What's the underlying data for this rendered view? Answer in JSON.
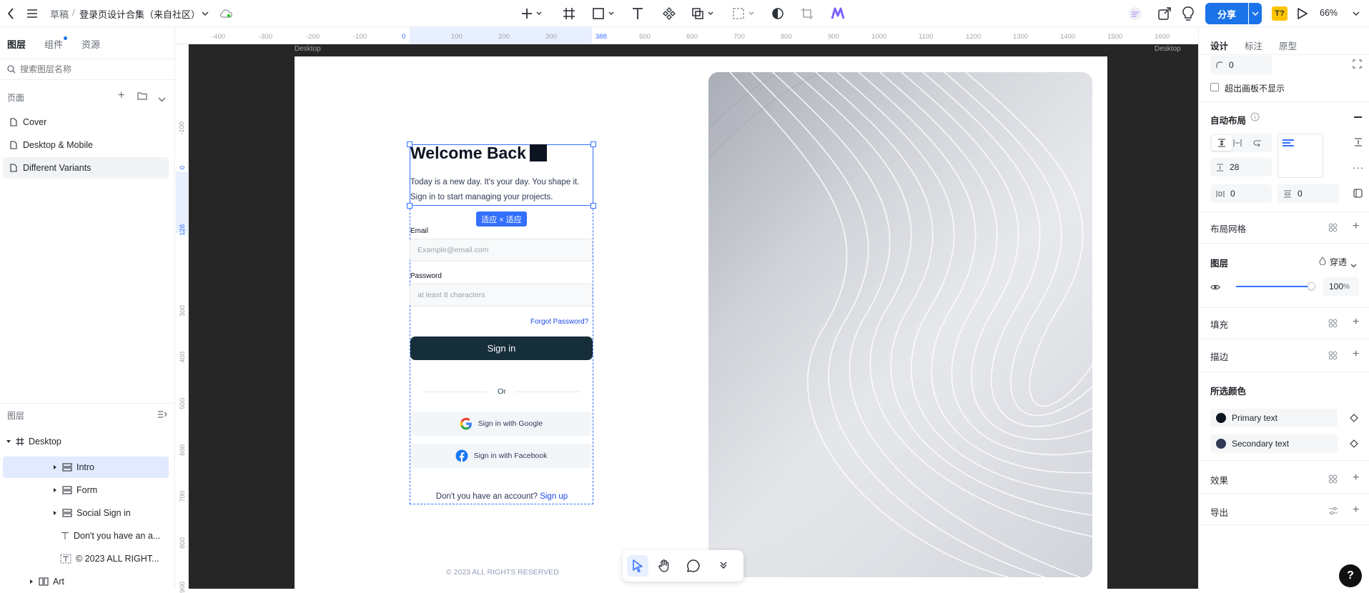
{
  "topbar": {
    "breadcrumb_parent": "草稿",
    "breadcrumb_sep": "/",
    "file_name": "登录页设计合集（来自社区）",
    "share_label": "分享",
    "zoom": "66%"
  },
  "left_panel": {
    "tabs": [
      "图层",
      "组件",
      "资源"
    ],
    "search_placeholder": "搜索图层名称",
    "pages_title": "页面",
    "pages": [
      "Cover",
      "Desktop & Mobile",
      "Different Variants"
    ],
    "layers_title": "图层",
    "layers": {
      "root": "Desktop",
      "children": [
        "Intro",
        "Form",
        "Social Sign in",
        "Don't you have an a...",
        "© 2023 ALL RIGHT...",
        "Art"
      ]
    }
  },
  "rulers": {
    "h": [
      "-400",
      "-300",
      "-200",
      "-100",
      "0",
      "100",
      "200",
      "300",
      "388",
      "500",
      "600",
      "700",
      "800",
      "900",
      "1000",
      "1100",
      "1200",
      "1300",
      "1400",
      "1500",
      "1600"
    ],
    "v": [
      "-100",
      "0",
      "128",
      "300",
      "400",
      "500",
      "600",
      "700",
      "800",
      "900"
    ]
  },
  "canvas": {
    "frame_label": "Desktop",
    "frame_label_right": "Desktop",
    "size_badge": "适应 × 适应",
    "welcome": "Welcome Back",
    "subtitle_1": "Today is a new day. It's your day. You shape it.",
    "subtitle_2": "Sign in to start managing your projects.",
    "email_label": "Email",
    "email_placeholder": "Example@email.com",
    "password_label": "Password",
    "password_placeholder": "at least 8 characters",
    "forgot": "Forgot Password?",
    "signin": "Sign in",
    "or": "Or",
    "google": "Sign in with Google",
    "facebook": "Sign in with Facebook",
    "no_account": "Don't you have an account?",
    "signup": "Sign up",
    "copyright": "© 2023 ALL RIGHTS RESERVED"
  },
  "right_panel": {
    "tabs": [
      "设计",
      "标注",
      "原型"
    ],
    "corner_value": "0",
    "clip_label": "超出画板不显示",
    "auto_layout": "自动布局",
    "gap_value": "28",
    "pad_h": "0",
    "pad_v": "0",
    "layout_grid": "布局网格",
    "layer": "图层",
    "blend": "穿透",
    "opacity": "100",
    "opacity_unit": "%",
    "fill": "填充",
    "stroke": "描边",
    "selected_colors": "所选颜色",
    "colors": [
      {
        "name": "Primary text",
        "hex": "#0c1421"
      },
      {
        "name": "Secondary text",
        "hex": "#313957"
      }
    ],
    "effects": "效果",
    "export": "导出"
  },
  "colors": {
    "accent": "#3370ff",
    "brand": "#1a73e8",
    "button_dark": "#162d3a"
  }
}
